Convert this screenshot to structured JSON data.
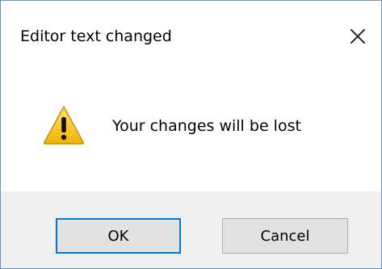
{
  "dialog": {
    "title": "Editor text changed",
    "message": "Your changes will be lost",
    "icons": {
      "close": "close-icon",
      "warning": "warning-icon"
    },
    "buttons": {
      "ok_label": "OK",
      "cancel_label": "Cancel"
    }
  },
  "colors": {
    "accent_focus": "#0078d7",
    "footer_bg": "#f0f0f0",
    "button_bg": "#e1e1e1",
    "warning_yellow": "#f4c20d"
  }
}
